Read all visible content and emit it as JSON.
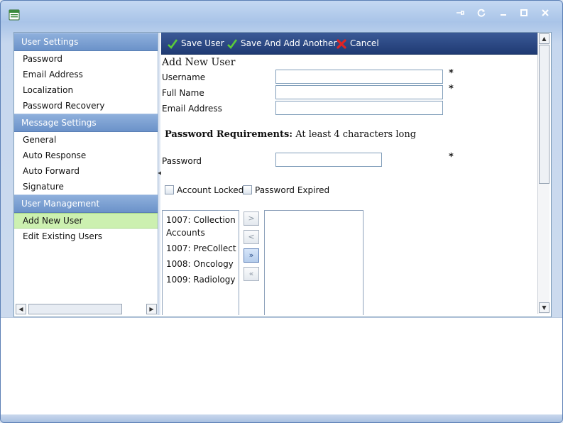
{
  "window": {
    "title_buttons": [
      "pin-icon",
      "refresh-icon",
      "minimize-icon",
      "maximize-icon",
      "close-icon"
    ]
  },
  "sidebar": {
    "groups": [
      {
        "label": "User Settings",
        "items": [
          "Password",
          "Email Address",
          "Localization",
          "Password Recovery"
        ]
      },
      {
        "label": "Message Settings",
        "items": [
          "General",
          "Auto Response",
          "Auto Forward",
          "Signature"
        ]
      },
      {
        "label": "User Management",
        "items": [
          "Add New User",
          "Edit Existing Users"
        ]
      }
    ],
    "selected": "Add New User"
  },
  "toolbar": {
    "save_user": "Save User",
    "save_and_add": "Save And Add Another",
    "cancel": "Cancel"
  },
  "form": {
    "title": "Add New User",
    "username_label": "Username",
    "fullname_label": "Full Name",
    "email_label": "Email Address",
    "required_mark": "*",
    "pw_req_bold": "Password Requirements:",
    "pw_req_text": " At least 4 characters long",
    "password_label": "Password",
    "account_locked": "Account Locked",
    "password_expired": "Password Expired"
  },
  "groups_list": {
    "available": [
      "1007: Collection Accounts",
      "1007: PreCollect",
      "1008: Oncology",
      "1009: Radiology"
    ],
    "assigned": []
  },
  "move_buttons": {
    "move_right": ">",
    "move_left": "<",
    "move_all_right": "»",
    "move_all_left": "«"
  },
  "colors": {
    "accent": "#2d4b86",
    "selected_item": "#ccf0b0",
    "group_header": "#7ea1d4"
  }
}
